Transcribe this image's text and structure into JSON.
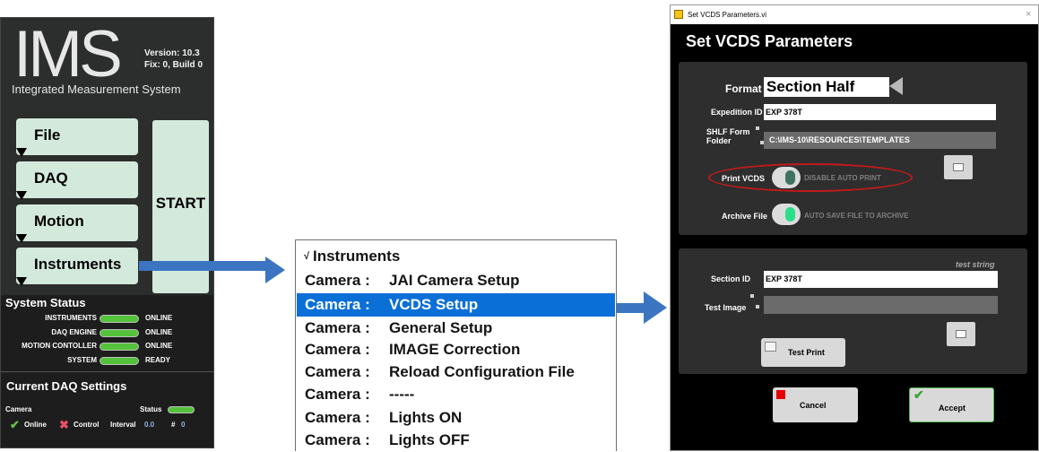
{
  "ims": {
    "logo": "IMS",
    "version_line1": "Version: 10.3",
    "version_line2": "Fix: 0, Build 0",
    "subtitle": "Integrated Measurement System",
    "menu": [
      "File",
      "DAQ",
      "Motion",
      "Instruments"
    ],
    "start_label": "START",
    "system_status_title": "System Status",
    "status_rows": [
      {
        "label": "INSTRUMENTS",
        "value": "ONLINE"
      },
      {
        "label": "DAQ ENGINE",
        "value": "ONLINE"
      },
      {
        "label": "MOTION CONTOLLER",
        "value": "ONLINE"
      },
      {
        "label": "SYSTEM",
        "value": "READY"
      }
    ],
    "daq_title": "Current DAQ Settings",
    "daq_camera": "Camera",
    "daq_status": "Status",
    "daq_online": "Online",
    "daq_control": "Control",
    "daq_interval_label": "Interval",
    "daq_interval_value": "0.0",
    "daq_count_label": "#",
    "daq_count_value": "0"
  },
  "dropdown": {
    "check": "√",
    "header": "Instruments",
    "category": "Camera :",
    "items": [
      "JAI Camera Setup",
      "VCDS Setup",
      "General Setup",
      "IMAGE Correction",
      "Reload Configuration File",
      "-----",
      "Lights ON",
      "Lights OFF"
    ],
    "selected": "VCDS Setup"
  },
  "dialog": {
    "window_title": "Set VCDS Parameters.vi",
    "close_glyph": "×",
    "heading": "Set VCDS Parameters",
    "format_label": "Format",
    "format_value": "Section Half",
    "expedition_label": "Expedition ID",
    "expedition_value": "EXP 378T",
    "shlf_label": "SHLF Form Folder",
    "shlf_value": "C:\\IMS-10\\RESOURCES\\TEMPLATES",
    "print_label": "Print VCDS",
    "print_toggle_text": "DISABLE AUTO PRINT",
    "archive_label": "Archive File",
    "archive_toggle_text": "AUTO SAVE FILE TO ARCHIVE",
    "test_string": "test string",
    "section_label": "Section ID",
    "section_value": "EXP 378T",
    "test_image_label": "Test Image",
    "test_print_label": "Test Print",
    "cancel_label": "Cancel",
    "accept_label": "Accept"
  },
  "colors": {
    "accent_blue": "#0a6fd6",
    "arrow_blue": "#3b75c2",
    "status_green": "#54c23a",
    "panel_dark": "#2c2d2d",
    "button_mint": "#d3e9dc",
    "highlight_red": "#c21a1a"
  }
}
